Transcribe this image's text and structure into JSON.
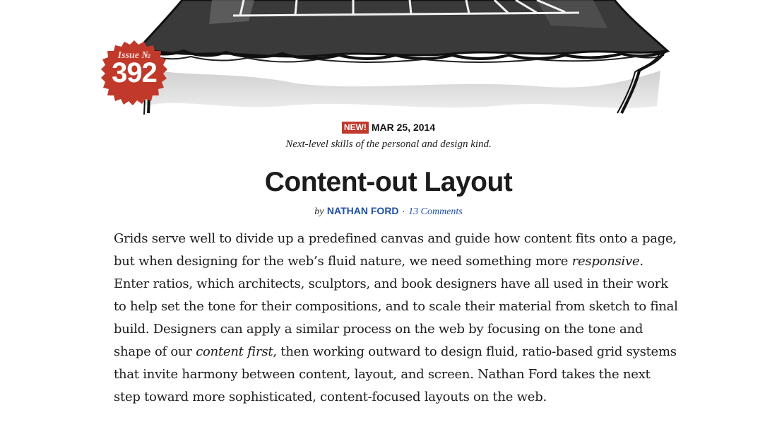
{
  "hero": {
    "illustration": "ink-and-watercolor-tent-illustration",
    "badge": {
      "label": "Issue №",
      "number": "392",
      "color": "#c0392b"
    }
  },
  "meta": {
    "new_label": "NEW!",
    "date": "MAR 25, 2014",
    "tagline": "Next-level skills of the personal and design kind."
  },
  "article": {
    "title": "Content-out Layout",
    "byline": {
      "by": "by",
      "author": "NATHAN FORD",
      "separator": "·",
      "comments": "13 Comments"
    },
    "intro": {
      "part1": "Grids serve well to divide up a predefined canvas and guide how content fits onto a page, but when designing for the web’s fluid nature, we need something more ",
      "em1": "responsive",
      "part2": ". Enter ratios, which architects, sculptors, and book designers have all used in their work to help set the tone for their compositions, and to scale their material from sketch to final build. Designers can apply a similar process on the web by focusing on the tone and shape of our ",
      "em2": "content first",
      "part3": ", then working outward to design fluid, ratio-based grid systems that invite harmony between content, layout, and screen. Nathan Ford takes the next step toward more sophisticated, content-focused layouts on the web."
    }
  },
  "colors": {
    "accent_red": "#c0392b",
    "link_blue": "#1d4fa8",
    "text": "#1c1c1c"
  }
}
